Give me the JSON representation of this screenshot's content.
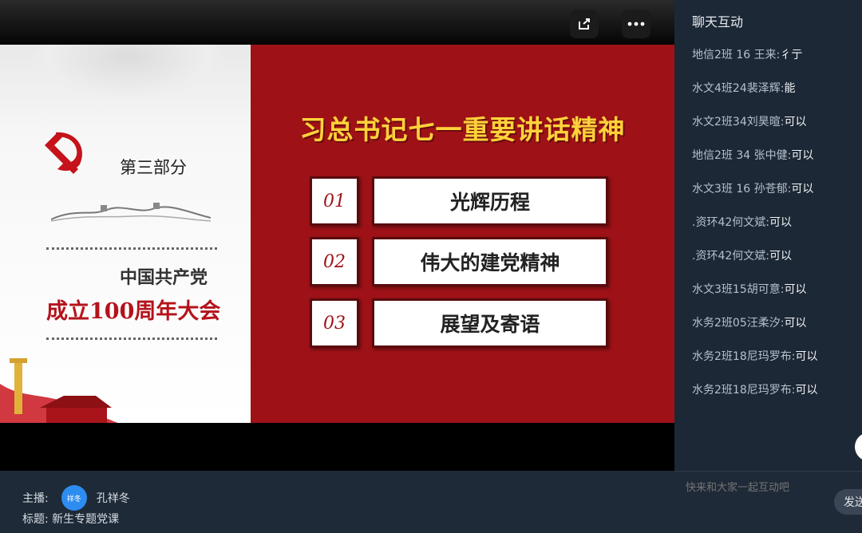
{
  "video": {
    "controls": {
      "share_icon": "share-icon",
      "more_icon": "more-icon"
    },
    "slide": {
      "part_label": "第三部分",
      "party_name": "中国共产党",
      "anniversary": "成立100周年大会",
      "main_title": "习总书记七一重要讲话精神",
      "items": [
        {
          "num": "01",
          "label": "光辉历程"
        },
        {
          "num": "02",
          "label": "伟大的建党精神"
        },
        {
          "num": "03",
          "label": "展望及寄语"
        }
      ]
    }
  },
  "info": {
    "host_label": "主播:",
    "host_avatar_text": "祥冬",
    "host_name": "孔祥冬",
    "title_label": "标题:",
    "title_value": "新生专题党课"
  },
  "chat": {
    "title": "聊天互动",
    "messages": [
      {
        "user": "地信2班 16 王来:",
        "text": "彳亍"
      },
      {
        "user": "水文4班24裴泽辉:",
        "text": "能"
      },
      {
        "user": "水文2班34刘昊暄:",
        "text": "可以"
      },
      {
        "user": "地信2班 34 张中健:",
        "text": "可以"
      },
      {
        "user": "水文3班 16 孙苍郁:",
        "text": "可以"
      },
      {
        "user": ".资环42何文斌:",
        "text": "可以"
      },
      {
        "user": ".资环42何文斌:",
        "text": "可以"
      },
      {
        "user": "水文3班15胡可意:",
        "text": "可以"
      },
      {
        "user": "水务2班05汪柔汐:",
        "text": "可以"
      },
      {
        "user": "水务2班18尼玛罗布:",
        "text": "可以"
      },
      {
        "user": "水务2班18尼玛罗布:",
        "text": "可以"
      }
    ],
    "input_placeholder": "快来和大家一起互动吧",
    "send_label": "发送"
  },
  "colors": {
    "slide_red": "#9e1217",
    "title_gold": "#ffd23a",
    "avatar_blue": "#2d8cf0",
    "panel_bg": "#1d2836"
  }
}
